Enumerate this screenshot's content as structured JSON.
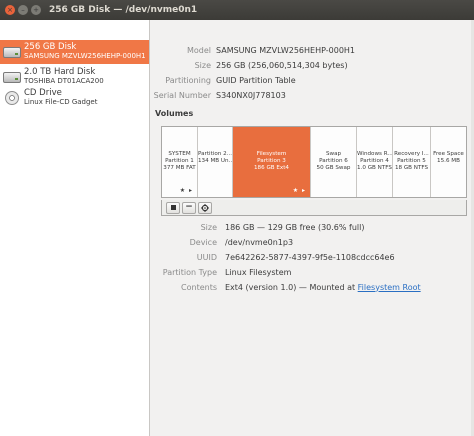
{
  "window": {
    "title": "256 GB Disk — /dev/nvme0n1",
    "close_glyph": "×",
    "min_glyph": "–",
    "max_glyph": "+"
  },
  "sidebar": {
    "drives": [
      {
        "name": "256 GB Disk",
        "sub": "SAMSUNG MZVLW256HEHP-000H1",
        "icon": "hard-disk-icon",
        "selected": true
      },
      {
        "name": "2.0 TB Hard Disk",
        "sub": "TOSHIBA DT01ACA200",
        "icon": "hard-disk-icon",
        "selected": false
      },
      {
        "name": "CD Drive",
        "sub": "Linux File-CD Gadget",
        "icon": "optical-disc-icon",
        "selected": false
      }
    ]
  },
  "disk_info": {
    "model_label": "Model",
    "model": "SAMSUNG MZVLW256HEHP-000H1",
    "size_label": "Size",
    "size": "256 GB (256,060,514,304 bytes)",
    "partitioning_label": "Partitioning",
    "partitioning": "GUID Partition Table",
    "serial_label": "Serial Number",
    "serial": "S340NX0J778103"
  },
  "volumes": {
    "title": "Volumes",
    "partitions": [
      {
        "line1": "SYSTEM",
        "line2": "Partition 1",
        "line3": "377 MB FAT",
        "stars": "★ ▸"
      },
      {
        "line1": "Partition 2...",
        "line2": "134 MB Un...",
        "line3": "",
        "stars": ""
      },
      {
        "line1": "Filesystem",
        "line2": "Partition 3",
        "line3": "186 GB Ext4",
        "stars": "★ ▸"
      },
      {
        "line1": "Swap",
        "line2": "Partition 6",
        "line3": "50 GB Swap",
        "stars": ""
      },
      {
        "line1": "Windows R...",
        "line2": "Partition 4",
        "line3": "1.0 GB NTFS",
        "stars": ""
      },
      {
        "line1": "Recovery I...",
        "line2": "Partition 5",
        "line3": "18 GB NTFS",
        "stars": ""
      },
      {
        "line1": "Free Space",
        "line2": "15.6 MB",
        "line3": "",
        "stars": ""
      }
    ],
    "toolbar": {
      "stop_icon": "stop-icon",
      "minus_glyph": "−",
      "settings_icon": "gear-icon"
    }
  },
  "partition_info": {
    "size_label": "Size",
    "size": "186 GB — 129 GB free (30.6% full)",
    "device_label": "Device",
    "device": "/dev/nvme0n1p3",
    "uuid_label": "UUID",
    "uuid": "7e642262-5877-4397-9f5e-1108cdcc64e6",
    "type_label": "Partition Type",
    "type": "Linux Filesystem",
    "contents_label": "Contents",
    "contents_prefix": "Ext4 (version 1.0) — Mounted at ",
    "contents_link": "Filesystem Root"
  },
  "colors": {
    "accent": "#f07746",
    "selected_partition": "#e86e3e",
    "titlebar": "#3c3b37",
    "close_button": "#e9633b"
  }
}
